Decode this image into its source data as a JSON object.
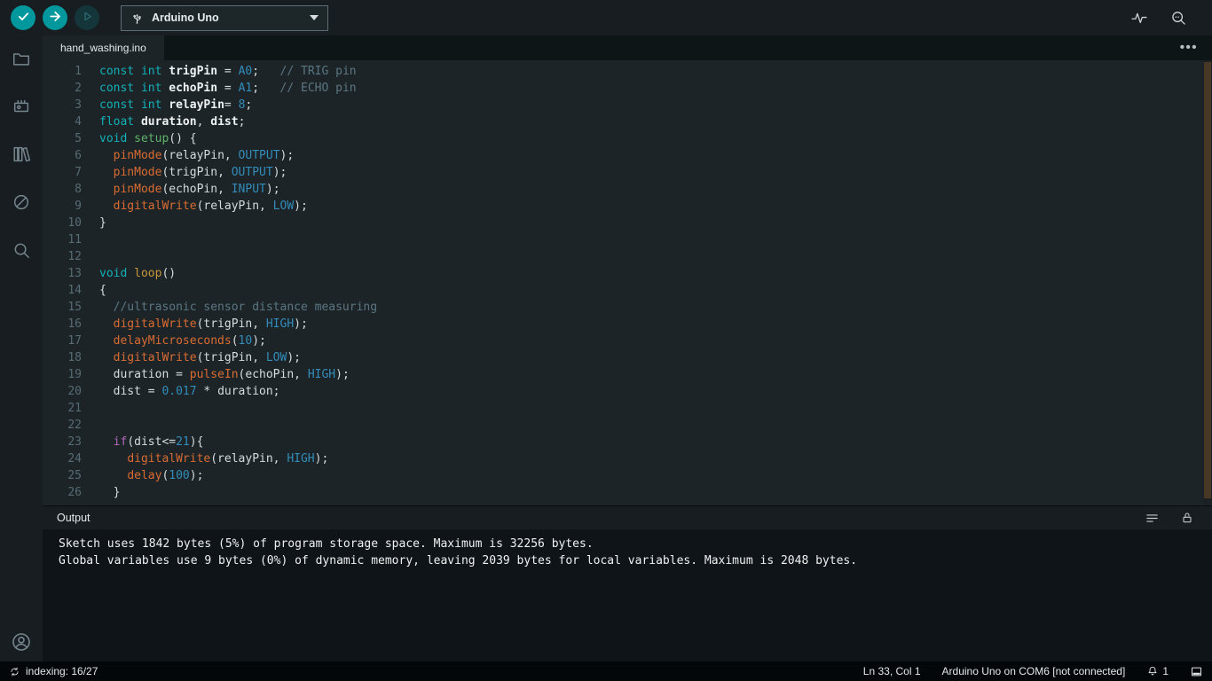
{
  "colors": {
    "accent_teal": "#00979d",
    "editor_background": "#1c2427",
    "statusbar_background": "#04070a",
    "keyword": "#13b1b8",
    "builtin_function": "#d96b33",
    "literal": "#338cba",
    "comment": "#5b7683",
    "control_keyword": "#b167b9"
  },
  "toolbar": {
    "board_selector": {
      "label": "Arduino Uno"
    }
  },
  "icons": {
    "toolbar": [
      "verify-icon",
      "upload-icon",
      "debug-icon",
      "usb-icon",
      "chevron-down-icon",
      "serial-plotter-icon",
      "serial-monitor-icon"
    ],
    "sidebar": [
      "sketchbook-folder-icon",
      "boards-manager-icon",
      "library-manager-icon",
      "debug-circle-slash-icon",
      "search-icon",
      "account-icon"
    ],
    "output_header": [
      "clear-output-icon",
      "scroll-lock-icon"
    ],
    "statusbar": [
      "sync-icon",
      "bell-icon",
      "toggle-bottom-panel-icon"
    ]
  },
  "tabs": [
    {
      "label": "hand_washing.ino"
    }
  ],
  "tabbar": {
    "more_actions": "•••"
  },
  "editor": {
    "lines": [
      [
        {
          "c": "kw",
          "t": "const"
        },
        {
          "c": "pln",
          "t": " "
        },
        {
          "c": "kw",
          "t": "int"
        },
        {
          "c": "pln",
          "t": " "
        },
        {
          "c": "var",
          "t": "trigPin"
        },
        {
          "c": "pln",
          "t": " = "
        },
        {
          "c": "num",
          "t": "A0"
        },
        {
          "c": "pln",
          "t": ";   "
        },
        {
          "c": "cmt",
          "t": "// TRIG pin"
        }
      ],
      [
        {
          "c": "kw",
          "t": "const"
        },
        {
          "c": "pln",
          "t": " "
        },
        {
          "c": "kw",
          "t": "int"
        },
        {
          "c": "pln",
          "t": " "
        },
        {
          "c": "var",
          "t": "echoPin"
        },
        {
          "c": "pln",
          "t": " = "
        },
        {
          "c": "num",
          "t": "A1"
        },
        {
          "c": "pln",
          "t": ";   "
        },
        {
          "c": "cmt",
          "t": "// ECHO pin"
        }
      ],
      [
        {
          "c": "kw",
          "t": "const"
        },
        {
          "c": "pln",
          "t": " "
        },
        {
          "c": "kw",
          "t": "int"
        },
        {
          "c": "pln",
          "t": " "
        },
        {
          "c": "var",
          "t": "relayPin"
        },
        {
          "c": "pln",
          "t": "= "
        },
        {
          "c": "num",
          "t": "8"
        },
        {
          "c": "pln",
          "t": ";"
        }
      ],
      [
        {
          "c": "kw",
          "t": "float"
        },
        {
          "c": "pln",
          "t": " "
        },
        {
          "c": "var",
          "t": "duration"
        },
        {
          "c": "pln",
          "t": ", "
        },
        {
          "c": "var",
          "t": "dist"
        },
        {
          "c": "pln",
          "t": ";"
        }
      ],
      [
        {
          "c": "kw",
          "t": "void"
        },
        {
          "c": "pln",
          "t": " "
        },
        {
          "c": "def",
          "t": "setup"
        },
        {
          "c": "pln",
          "t": "() {"
        }
      ],
      [
        {
          "c": "pln",
          "t": "  "
        },
        {
          "c": "fn",
          "t": "pinMode"
        },
        {
          "c": "pln",
          "t": "(relayPin, "
        },
        {
          "c": "num",
          "t": "OUTPUT"
        },
        {
          "c": "pln",
          "t": ");"
        }
      ],
      [
        {
          "c": "pln",
          "t": "  "
        },
        {
          "c": "fn",
          "t": "pinMode"
        },
        {
          "c": "pln",
          "t": "(trigPin, "
        },
        {
          "c": "num",
          "t": "OUTPUT"
        },
        {
          "c": "pln",
          "t": ");"
        }
      ],
      [
        {
          "c": "pln",
          "t": "  "
        },
        {
          "c": "fn",
          "t": "pinMode"
        },
        {
          "c": "pln",
          "t": "(echoPin, "
        },
        {
          "c": "num",
          "t": "INPUT"
        },
        {
          "c": "pln",
          "t": ");"
        }
      ],
      [
        {
          "c": "pln",
          "t": "  "
        },
        {
          "c": "fn",
          "t": "digitalWrite"
        },
        {
          "c": "pln",
          "t": "(relayPin, "
        },
        {
          "c": "num",
          "t": "LOW"
        },
        {
          "c": "pln",
          "t": ");"
        }
      ],
      [
        {
          "c": "pln",
          "t": "}"
        }
      ],
      [],
      [],
      [
        {
          "c": "kw",
          "t": "void"
        },
        {
          "c": "pln",
          "t": " "
        },
        {
          "c": "fn2",
          "t": "loop"
        },
        {
          "c": "pln",
          "t": "()"
        }
      ],
      [
        {
          "c": "pln",
          "t": "{"
        }
      ],
      [
        {
          "c": "pln",
          "t": "  "
        },
        {
          "c": "cmt",
          "t": "//ultrasonic sensor distance measuring"
        }
      ],
      [
        {
          "c": "pln",
          "t": "  "
        },
        {
          "c": "fn",
          "t": "digitalWrite"
        },
        {
          "c": "pln",
          "t": "(trigPin, "
        },
        {
          "c": "num",
          "t": "HIGH"
        },
        {
          "c": "pln",
          "t": ");"
        }
      ],
      [
        {
          "c": "pln",
          "t": "  "
        },
        {
          "c": "fn",
          "t": "delayMicroseconds"
        },
        {
          "c": "pln",
          "t": "("
        },
        {
          "c": "num",
          "t": "10"
        },
        {
          "c": "pln",
          "t": ");"
        }
      ],
      [
        {
          "c": "pln",
          "t": "  "
        },
        {
          "c": "fn",
          "t": "digitalWrite"
        },
        {
          "c": "pln",
          "t": "(trigPin, "
        },
        {
          "c": "num",
          "t": "LOW"
        },
        {
          "c": "pln",
          "t": ");"
        }
      ],
      [
        {
          "c": "pln",
          "t": "  duration = "
        },
        {
          "c": "fn",
          "t": "pulseIn"
        },
        {
          "c": "pln",
          "t": "(echoPin, "
        },
        {
          "c": "num",
          "t": "HIGH"
        },
        {
          "c": "pln",
          "t": ");"
        }
      ],
      [
        {
          "c": "pln",
          "t": "  dist = "
        },
        {
          "c": "num",
          "t": "0.017"
        },
        {
          "c": "pln",
          "t": " * duration;"
        }
      ],
      [],
      [],
      [
        {
          "c": "pln",
          "t": "  "
        },
        {
          "c": "ctrl",
          "t": "if"
        },
        {
          "c": "pln",
          "t": "(dist<="
        },
        {
          "c": "num",
          "t": "21"
        },
        {
          "c": "pln",
          "t": "){"
        }
      ],
      [
        {
          "c": "pln",
          "t": "    "
        },
        {
          "c": "fn",
          "t": "digitalWrite"
        },
        {
          "c": "pln",
          "t": "(relayPin, "
        },
        {
          "c": "num",
          "t": "HIGH"
        },
        {
          "c": "pln",
          "t": ");"
        }
      ],
      [
        {
          "c": "pln",
          "t": "    "
        },
        {
          "c": "fn",
          "t": "delay"
        },
        {
          "c": "pln",
          "t": "("
        },
        {
          "c": "num",
          "t": "100"
        },
        {
          "c": "pln",
          "t": ");"
        }
      ],
      [
        {
          "c": "pln",
          "t": "  }"
        }
      ]
    ]
  },
  "output": {
    "title": "Output",
    "lines": [
      "Sketch uses 1842 bytes (5%) of program storage space. Maximum is 32256 bytes.",
      "Global variables use 9 bytes (0%) of dynamic memory, leaving 2039 bytes for local variables. Maximum is 2048 bytes."
    ]
  },
  "statusbar": {
    "indexing_label": "indexing: 16/27",
    "cursor_position": "Ln 33, Col 1",
    "board_status": "Arduino Uno on COM6 [not connected]",
    "notification_count": "1"
  }
}
